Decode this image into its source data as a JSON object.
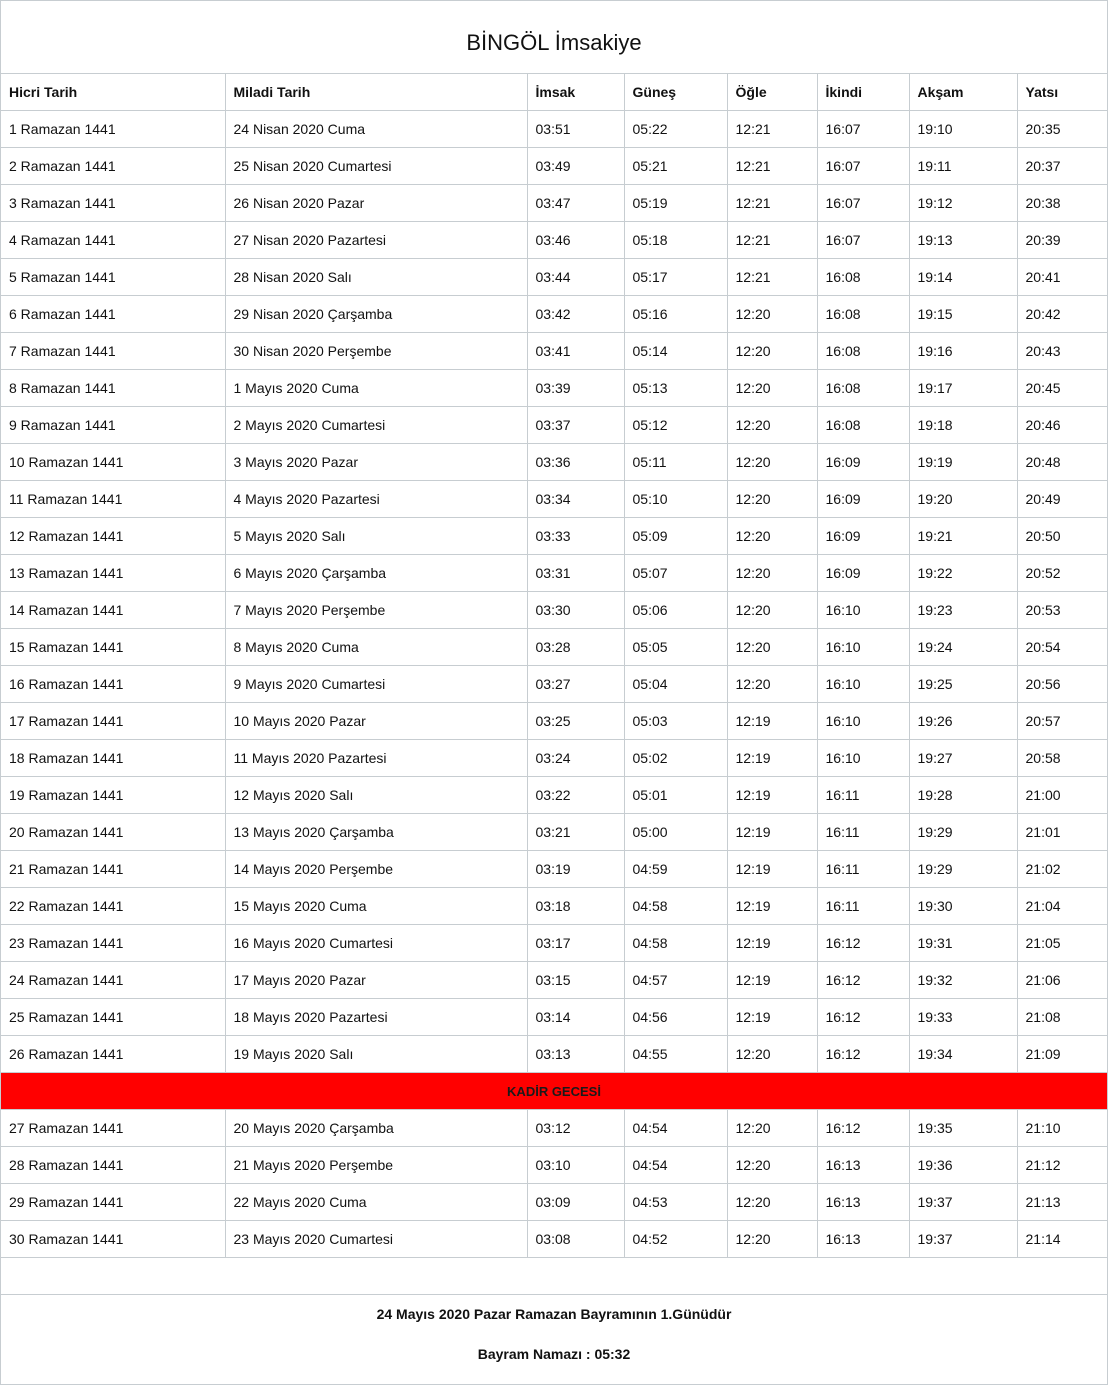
{
  "title": "BİNGÖL İmsakiye",
  "columns": [
    "Hicri Tarih",
    "Miladi Tarih",
    "İmsak",
    "Güneş",
    "Öğle",
    "İkindi",
    "Akşam",
    "Yatsı"
  ],
  "rows_before": [
    [
      "1 Ramazan 1441",
      "24 Nisan 2020 Cuma",
      "03:51",
      "05:22",
      "12:21",
      "16:07",
      "19:10",
      "20:35"
    ],
    [
      "2 Ramazan 1441",
      "25 Nisan 2020 Cumartesi",
      "03:49",
      "05:21",
      "12:21",
      "16:07",
      "19:11",
      "20:37"
    ],
    [
      "3 Ramazan 1441",
      "26 Nisan 2020 Pazar",
      "03:47",
      "05:19",
      "12:21",
      "16:07",
      "19:12",
      "20:38"
    ],
    [
      "4 Ramazan 1441",
      "27 Nisan 2020 Pazartesi",
      "03:46",
      "05:18",
      "12:21",
      "16:07",
      "19:13",
      "20:39"
    ],
    [
      "5 Ramazan 1441",
      "28 Nisan 2020 Salı",
      "03:44",
      "05:17",
      "12:21",
      "16:08",
      "19:14",
      "20:41"
    ],
    [
      "6 Ramazan 1441",
      "29 Nisan 2020 Çarşamba",
      "03:42",
      "05:16",
      "12:20",
      "16:08",
      "19:15",
      "20:42"
    ],
    [
      "7 Ramazan 1441",
      "30 Nisan 2020 Perşembe",
      "03:41",
      "05:14",
      "12:20",
      "16:08",
      "19:16",
      "20:43"
    ],
    [
      "8 Ramazan 1441",
      "1 Mayıs 2020 Cuma",
      "03:39",
      "05:13",
      "12:20",
      "16:08",
      "19:17",
      "20:45"
    ],
    [
      "9 Ramazan 1441",
      "2 Mayıs 2020 Cumartesi",
      "03:37",
      "05:12",
      "12:20",
      "16:08",
      "19:18",
      "20:46"
    ],
    [
      "10 Ramazan 1441",
      "3 Mayıs 2020 Pazar",
      "03:36",
      "05:11",
      "12:20",
      "16:09",
      "19:19",
      "20:48"
    ],
    [
      "11 Ramazan 1441",
      "4 Mayıs 2020 Pazartesi",
      "03:34",
      "05:10",
      "12:20",
      "16:09",
      "19:20",
      "20:49"
    ],
    [
      "12 Ramazan 1441",
      "5 Mayıs 2020 Salı",
      "03:33",
      "05:09",
      "12:20",
      "16:09",
      "19:21",
      "20:50"
    ],
    [
      "13 Ramazan 1441",
      "6 Mayıs 2020 Çarşamba",
      "03:31",
      "05:07",
      "12:20",
      "16:09",
      "19:22",
      "20:52"
    ],
    [
      "14 Ramazan 1441",
      "7 Mayıs 2020 Perşembe",
      "03:30",
      "05:06",
      "12:20",
      "16:10",
      "19:23",
      "20:53"
    ],
    [
      "15 Ramazan 1441",
      "8 Mayıs 2020 Cuma",
      "03:28",
      "05:05",
      "12:20",
      "16:10",
      "19:24",
      "20:54"
    ],
    [
      "16 Ramazan 1441",
      "9 Mayıs 2020 Cumartesi",
      "03:27",
      "05:04",
      "12:20",
      "16:10",
      "19:25",
      "20:56"
    ],
    [
      "17 Ramazan 1441",
      "10 Mayıs 2020 Pazar",
      "03:25",
      "05:03",
      "12:19",
      "16:10",
      "19:26",
      "20:57"
    ],
    [
      "18 Ramazan 1441",
      "11 Mayıs 2020 Pazartesi",
      "03:24",
      "05:02",
      "12:19",
      "16:10",
      "19:27",
      "20:58"
    ],
    [
      "19 Ramazan 1441",
      "12 Mayıs 2020 Salı",
      "03:22",
      "05:01",
      "12:19",
      "16:11",
      "19:28",
      "21:00"
    ],
    [
      "20 Ramazan 1441",
      "13 Mayıs 2020 Çarşamba",
      "03:21",
      "05:00",
      "12:19",
      "16:11",
      "19:29",
      "21:01"
    ],
    [
      "21 Ramazan 1441",
      "14 Mayıs 2020 Perşembe",
      "03:19",
      "04:59",
      "12:19",
      "16:11",
      "19:29",
      "21:02"
    ],
    [
      "22 Ramazan 1441",
      "15 Mayıs 2020 Cuma",
      "03:18",
      "04:58",
      "12:19",
      "16:11",
      "19:30",
      "21:04"
    ],
    [
      "23 Ramazan 1441",
      "16 Mayıs 2020 Cumartesi",
      "03:17",
      "04:58",
      "12:19",
      "16:12",
      "19:31",
      "21:05"
    ],
    [
      "24 Ramazan 1441",
      "17 Mayıs 2020 Pazar",
      "03:15",
      "04:57",
      "12:19",
      "16:12",
      "19:32",
      "21:06"
    ],
    [
      "25 Ramazan 1441",
      "18 Mayıs 2020 Pazartesi",
      "03:14",
      "04:56",
      "12:19",
      "16:12",
      "19:33",
      "21:08"
    ],
    [
      "26 Ramazan 1441",
      "19 Mayıs 2020 Salı",
      "03:13",
      "04:55",
      "12:20",
      "16:12",
      "19:34",
      "21:09"
    ]
  ],
  "kadir_label": "KADİR GECESİ",
  "kadir_color": "#ff0000",
  "rows_after": [
    [
      "27 Ramazan 1441",
      "20 Mayıs 2020 Çarşamba",
      "03:12",
      "04:54",
      "12:20",
      "16:12",
      "19:35",
      "21:10"
    ],
    [
      "28 Ramazan 1441",
      "21 Mayıs 2020 Perşembe",
      "03:10",
      "04:54",
      "12:20",
      "16:13",
      "19:36",
      "21:12"
    ],
    [
      "29 Ramazan 1441",
      "22 Mayıs 2020 Cuma",
      "03:09",
      "04:53",
      "12:20",
      "16:13",
      "19:37",
      "21:13"
    ],
    [
      "30 Ramazan 1441",
      "23 Mayıs 2020 Cumartesi",
      "03:08",
      "04:52",
      "12:20",
      "16:13",
      "19:37",
      "21:14"
    ]
  ],
  "footer": {
    "bayram_line": "24 Mayıs 2020 Pazar Ramazan Bayramının 1.Günüdür",
    "namaz_line": "Bayram Namazı : 05:32"
  }
}
